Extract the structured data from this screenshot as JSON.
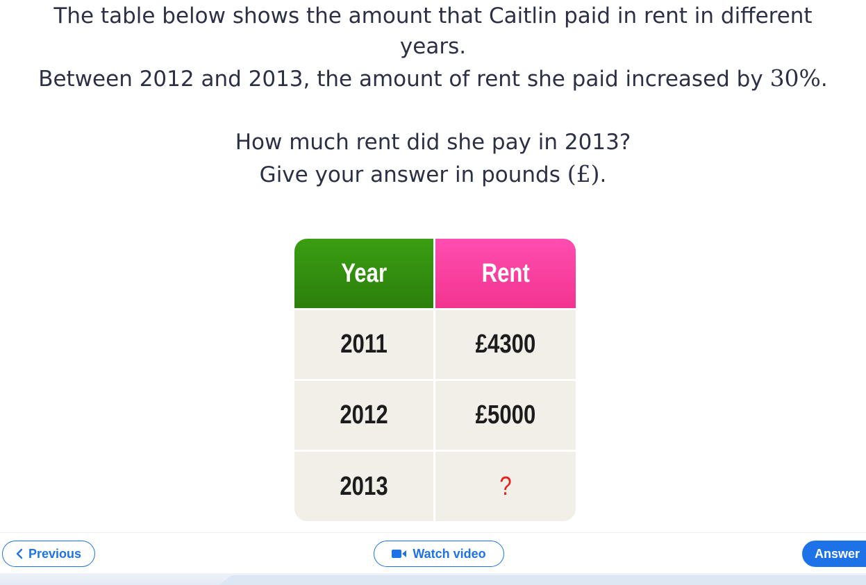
{
  "question": {
    "line1": "The table below shows the amount that Caitlin paid in rent in different",
    "line2": "years.",
    "line3_text": "Between 2012 and 2013, the amount of rent she paid increased by ",
    "line3_math": "30%",
    "line3_end": ".",
    "line4": "How much rent did she pay in 2013?",
    "line5_text": "Give your answer in pounds ",
    "line5_math": "(£)",
    "line5_end": "."
  },
  "table": {
    "headers": [
      "Year",
      "Rent"
    ],
    "rows": [
      {
        "year": "2011",
        "rent": "£4300"
      },
      {
        "year": "2012",
        "rent": "£5000"
      },
      {
        "year": "2013",
        "rent": "?"
      }
    ],
    "colors": {
      "year_header": "#2c8a0e",
      "rent_header": "#f83c9f",
      "cell_bg": "#f2efe9",
      "unknown": "#e3251f"
    }
  },
  "footer": {
    "previous_label": "Previous",
    "previous_icon": "chevron-left-icon",
    "video_label": "Watch video",
    "video_icon": "video-camera-icon",
    "answer_label": "Answer",
    "accent_color": "#1e72e8"
  }
}
